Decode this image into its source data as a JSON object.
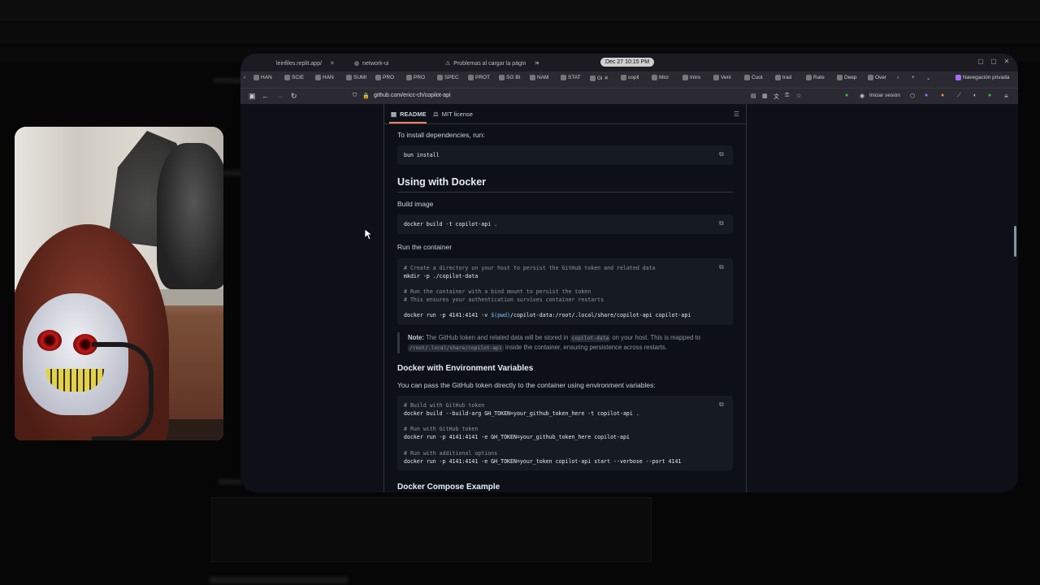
{
  "browser": {
    "tabs": [
      {
        "label": "leinfiles.replit.app/",
        "active": false
      },
      {
        "label": "network-ui",
        "active": false
      },
      {
        "label": "Problemas al cargar la págin",
        "active": false
      },
      {
        "label": "Gi",
        "active": true
      }
    ],
    "new_tab": "+",
    "clock": "Dec 27  10:15 PM",
    "bookmarks": [
      "HAN",
      "SCIE",
      "HAN",
      "SUMI",
      "PRO",
      "PRO",
      "SPEC",
      "PROT",
      "SG BI",
      "NAM",
      "STAT",
      "copil",
      "Micr",
      "Intro",
      "Veni",
      "Cuot",
      "trad",
      "Rate",
      "Deep",
      "Over"
    ],
    "private_label": "Navegación privada",
    "url": "github.com/ericc-ch/copilot-api",
    "login": "Iniciar sesión"
  },
  "readme": {
    "tabs": [
      {
        "label": "README",
        "icon": "book-icon"
      },
      {
        "label": "MIT license",
        "icon": "scale-icon"
      }
    ],
    "install_text": "To install dependencies, run:",
    "install_cmd": "bun install",
    "docker_heading": "Using with Docker",
    "build_label": "Build image",
    "build_cmd": "docker build -t copilot-api .",
    "run_label": "Run the container",
    "run_code": {
      "c1": "# Create a directory on your host to persist the GitHub token and related data",
      "l1": "mkdir -p ./copilot-data",
      "c2": "# Run the container with a bind mount to persist the token",
      "c3": "# This ensures your authentication survives container restarts",
      "l2_pre": "docker run -p 4141:4141 -v ",
      "l2_var": "$(pwd)",
      "l2_post": "/copilot-data:/root/.local/share/copilot-api copilot-api"
    },
    "note": {
      "label": "Note:",
      "t1": " The GitHub token and related data will be stored in ",
      "code1": "copilot-data",
      "t2": " on your host. This is mapped to",
      "code2": "/root/.local/share/copilot-api",
      "t3": " inside the container, ensuring persistence across restarts."
    },
    "env_heading": "Docker with Environment Variables",
    "env_text": "You can pass the GitHub token directly to the container using environment variables:",
    "env_code": {
      "c1": "# Build with GitHub token",
      "l1": "docker build --build-arg GH_TOKEN=your_github_token_here -t copilot-api .",
      "c2": "# Run with GitHub token",
      "l2": "docker run -p 4141:4141 -e GH_TOKEN=your_github_token_here copilot-api",
      "c3": "# Run with additional options",
      "l3": "docker run -p 4141:4141 -e GH_TOKEN=your_token copilot-api start --verbose --port 4141"
    },
    "compose_heading": "Docker Compose Example"
  },
  "colors": {
    "page_bg": "#0d1117",
    "code_bg": "#161b22",
    "accent": "#f78166"
  }
}
